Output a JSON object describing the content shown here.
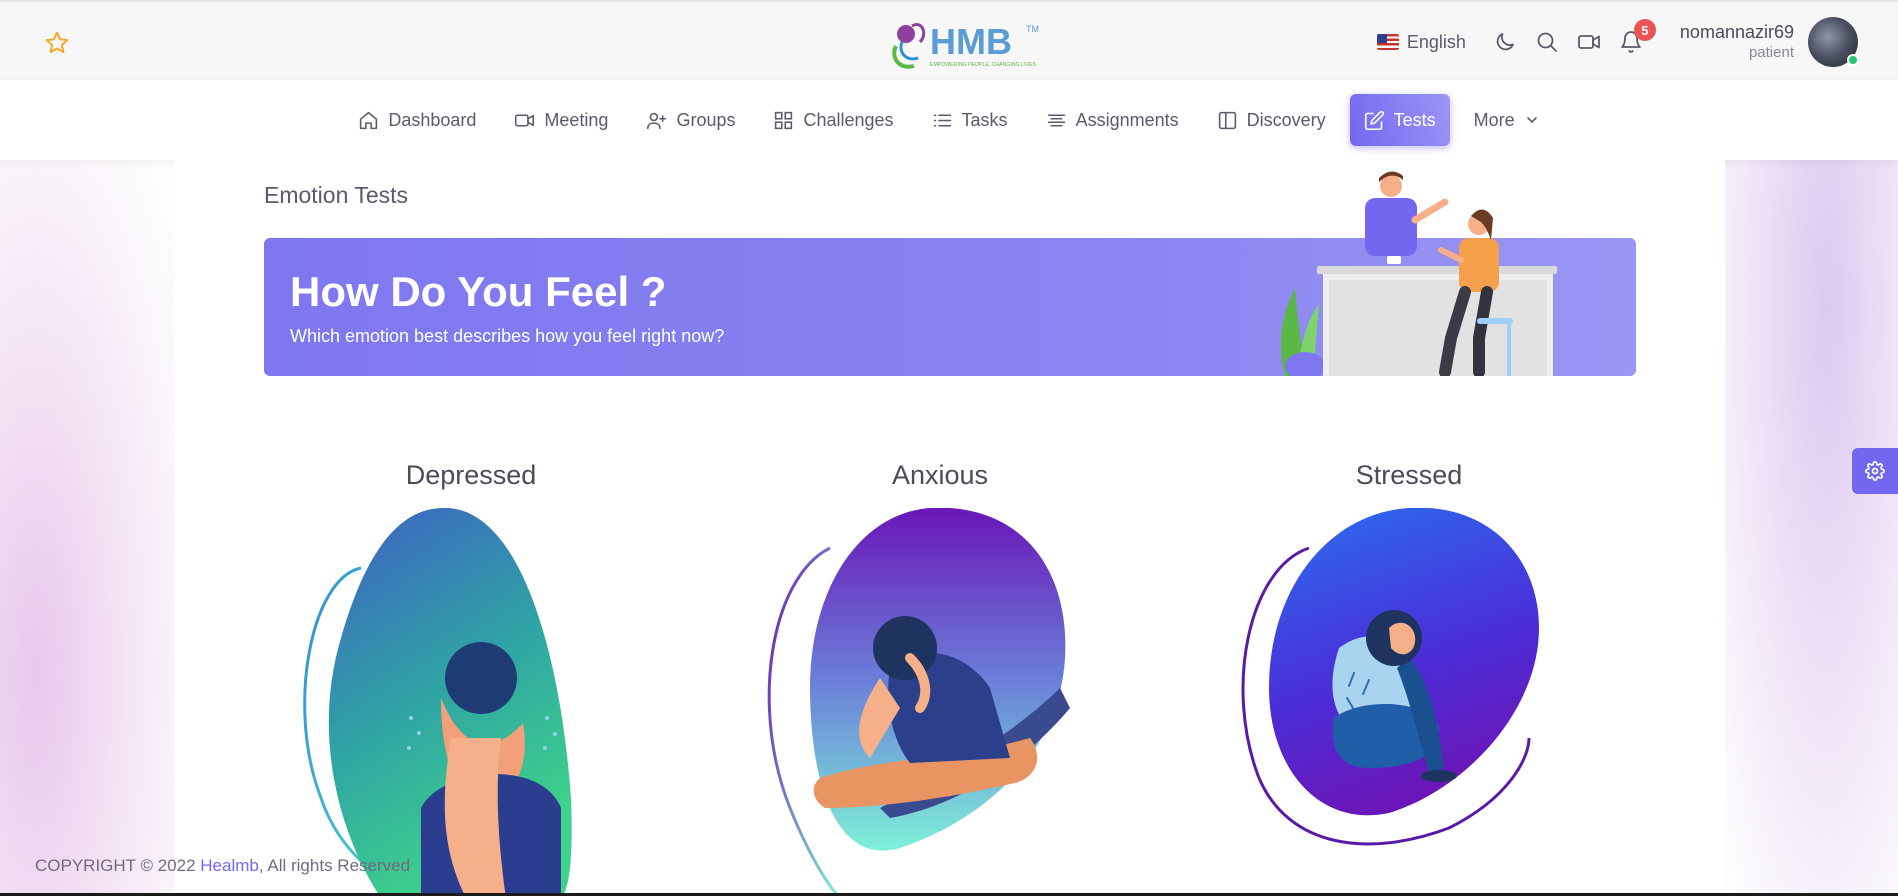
{
  "header": {
    "favorite_icon": "star-icon",
    "logo_text": "HMB",
    "logo_tagline": "EMPOWERING PEOPLE, CHANGING LIVES",
    "language": "English",
    "notification_count": "5",
    "user_name": "nomannazir69",
    "user_role": "patient"
  },
  "nav": {
    "items": [
      {
        "label": "Dashboard",
        "icon": "home-icon"
      },
      {
        "label": "Meeting",
        "icon": "video-icon"
      },
      {
        "label": "Groups",
        "icon": "user-plus-icon"
      },
      {
        "label": "Challenges",
        "icon": "grid-icon"
      },
      {
        "label": "Tasks",
        "icon": "list-icon"
      },
      {
        "label": "Assignments",
        "icon": "align-center-icon"
      },
      {
        "label": "Discovery",
        "icon": "book-icon"
      },
      {
        "label": "Tests",
        "icon": "edit-icon"
      },
      {
        "label": "More",
        "icon": "chevron-down-icon"
      }
    ],
    "active": "Tests"
  },
  "main": {
    "page_title": "Emotion Tests",
    "banner_title": "How Do You Feel ?",
    "banner_subtitle": "Which emotion best describes how you feel right now?",
    "emotions": [
      {
        "label": "Depressed"
      },
      {
        "label": "Anxious"
      },
      {
        "label": "Stressed"
      }
    ]
  },
  "footer": {
    "prefix": "COPYRIGHT © 2022 ",
    "brand": "Healmb",
    "suffix": ", All rights Reserved"
  },
  "colors": {
    "primary": "#7367f0",
    "badge": "#ea5455",
    "online": "#28c76f"
  }
}
